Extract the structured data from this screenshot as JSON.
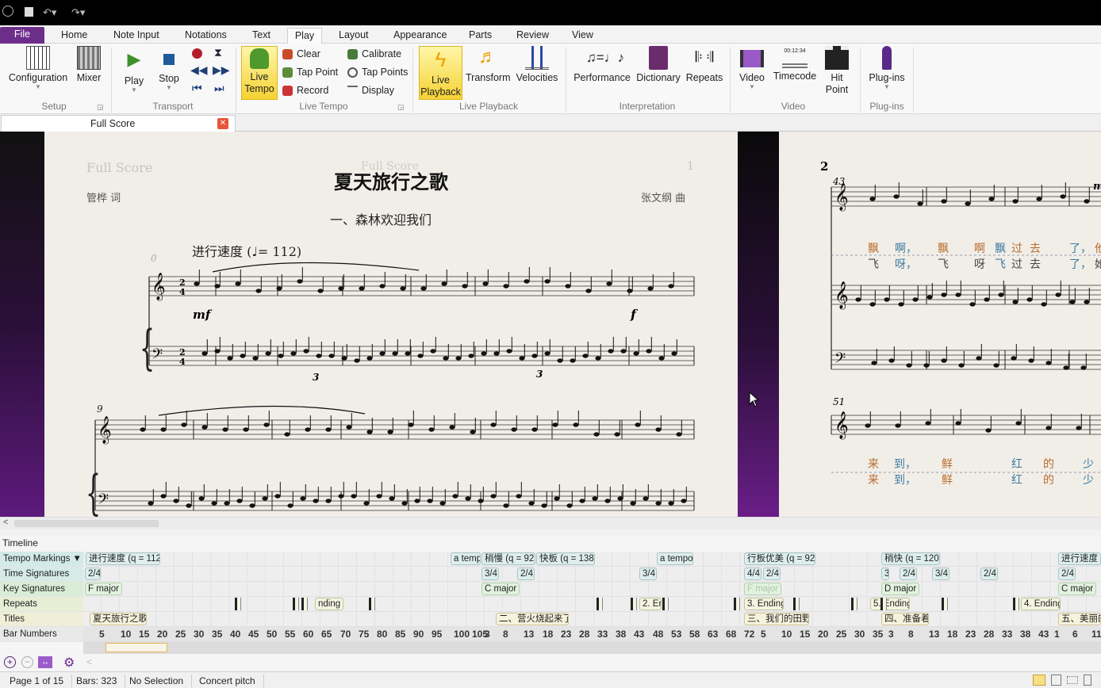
{
  "quick_access": {
    "icons": [
      "sibelius-logo-icon",
      "save-icon",
      "undo-icon",
      "redo-icon"
    ]
  },
  "tabs": [
    "File",
    "Home",
    "Note Input",
    "Notations",
    "Text",
    "Play",
    "Layout",
    "Appearance",
    "Parts",
    "Review",
    "View"
  ],
  "active_tab": "Play",
  "ribbon": {
    "setup": {
      "label": "Setup",
      "configuration": "Configuration",
      "mixer": "Mixer"
    },
    "transport": {
      "label": "Transport",
      "play": "Play",
      "stop": "Stop"
    },
    "live_tempo": {
      "label": "Live Tempo",
      "live_tempo": "Live Tempo",
      "clear": "Clear",
      "tap_point": "Tap Point",
      "record": "Record",
      "calibrate": "Calibrate",
      "tap_points": "Tap Points",
      "display": "Display"
    },
    "live_playback": {
      "label": "Live Playback",
      "live_playback": "Live Playback",
      "transform": "Transform",
      "velocities": "Velocities"
    },
    "interpretation": {
      "label": "Interpretation",
      "performance": "Performance",
      "dictionary": "Dictionary",
      "repeats": "Repeats"
    },
    "video": {
      "label": "Video",
      "video": "Video",
      "timecode": "Timecode",
      "timecode_display": "00:12:34",
      "hit_point": "Hit Point"
    },
    "plugins": {
      "label": "Plug-ins",
      "plugins": "Plug-ins"
    }
  },
  "document_tab": {
    "label": "Full Score"
  },
  "score": {
    "page1": {
      "header_left": "Full Score",
      "header_center": "Full Score",
      "page_number": "1",
      "title": "夏天旅行之歌",
      "lyricist": "管桦 词",
      "composer": "张文纲 曲",
      "subtitle": "一、森林欢迎我们",
      "tempo": "进行速度 (♩= 112)",
      "bar_num_1": "0",
      "bar_num_2": "9",
      "dyn_1": "mf",
      "dyn_2": "f",
      "triplet": "3"
    },
    "page2": {
      "page_number": "2",
      "bar_num_1": "43",
      "bar_num_2": "51",
      "dyn": "mf",
      "lyrics_1a": [
        "飘",
        "啊，",
        "飘",
        "啊",
        "飘",
        "过",
        "去",
        "了，",
        "他"
      ],
      "lyrics_1b": [
        "飞",
        "呀，",
        "飞",
        "呀",
        "飞",
        "过",
        "去",
        "了，",
        "她"
      ],
      "lyrics_2a": [
        "来",
        "到，",
        "鲜",
        "红",
        "的",
        "少"
      ],
      "lyrics_2b": [
        "来",
        "到，",
        "鲜",
        "红",
        "的",
        "少"
      ]
    }
  },
  "timeline": {
    "title": "Timeline",
    "rows": [
      "Tempo Markings ▼",
      "Time Signatures",
      "Key Signatures",
      "Repeats",
      "Titles",
      "Bar Numbers"
    ],
    "tempo": [
      "进行速度 (q = 112)",
      "a temp",
      "稍慢 (q = 92)",
      "快板 (q = 138)",
      "a tempo",
      "行板优美 (q = 92)",
      "稍快 (q = 120)",
      "进行速度 (q"
    ],
    "time_signatures": [
      "2/4",
      "3/4",
      "2/4",
      "3/4",
      "4/4",
      "2/4",
      "3",
      "2/4",
      "3/4",
      "2/4",
      "2/4"
    ],
    "key_signatures": [
      "F major",
      "C major",
      "F major",
      "D major",
      "C major"
    ],
    "repeats": [
      "nding",
      "2. En",
      "3. Ending",
      "5. Ending",
      "4. Ending"
    ],
    "titles": [
      "夏天旅行之歌",
      "二、营火烧起来了",
      "三、我们的田野",
      "四、准备着",
      "五、美丽的"
    ],
    "bar_numbers": [
      "5",
      "10",
      "15",
      "20",
      "25",
      "30",
      "35",
      "40",
      "45",
      "50",
      "55",
      "60",
      "65",
      "70",
      "75",
      "80",
      "85",
      "90",
      "95",
      "100",
      "105",
      "3",
      "8",
      "13",
      "18",
      "23",
      "28",
      "33",
      "38",
      "43",
      "48",
      "53",
      "58",
      "63",
      "68",
      "72",
      "5",
      "10",
      "15",
      "20",
      "25",
      "30",
      "35",
      "3",
      "8",
      "13",
      "18",
      "23",
      "28",
      "33",
      "38",
      "43",
      "1",
      "6",
      "11"
    ]
  },
  "status": {
    "page": "Page 1 of 15",
    "bars": "Bars: 323",
    "selection": "No Selection",
    "pitch": "Concert pitch"
  },
  "colors": {
    "file_tab": "#6d2e8a",
    "highlight": "#f5d233",
    "paper": "#f1eee8",
    "close": "#e8553a"
  }
}
